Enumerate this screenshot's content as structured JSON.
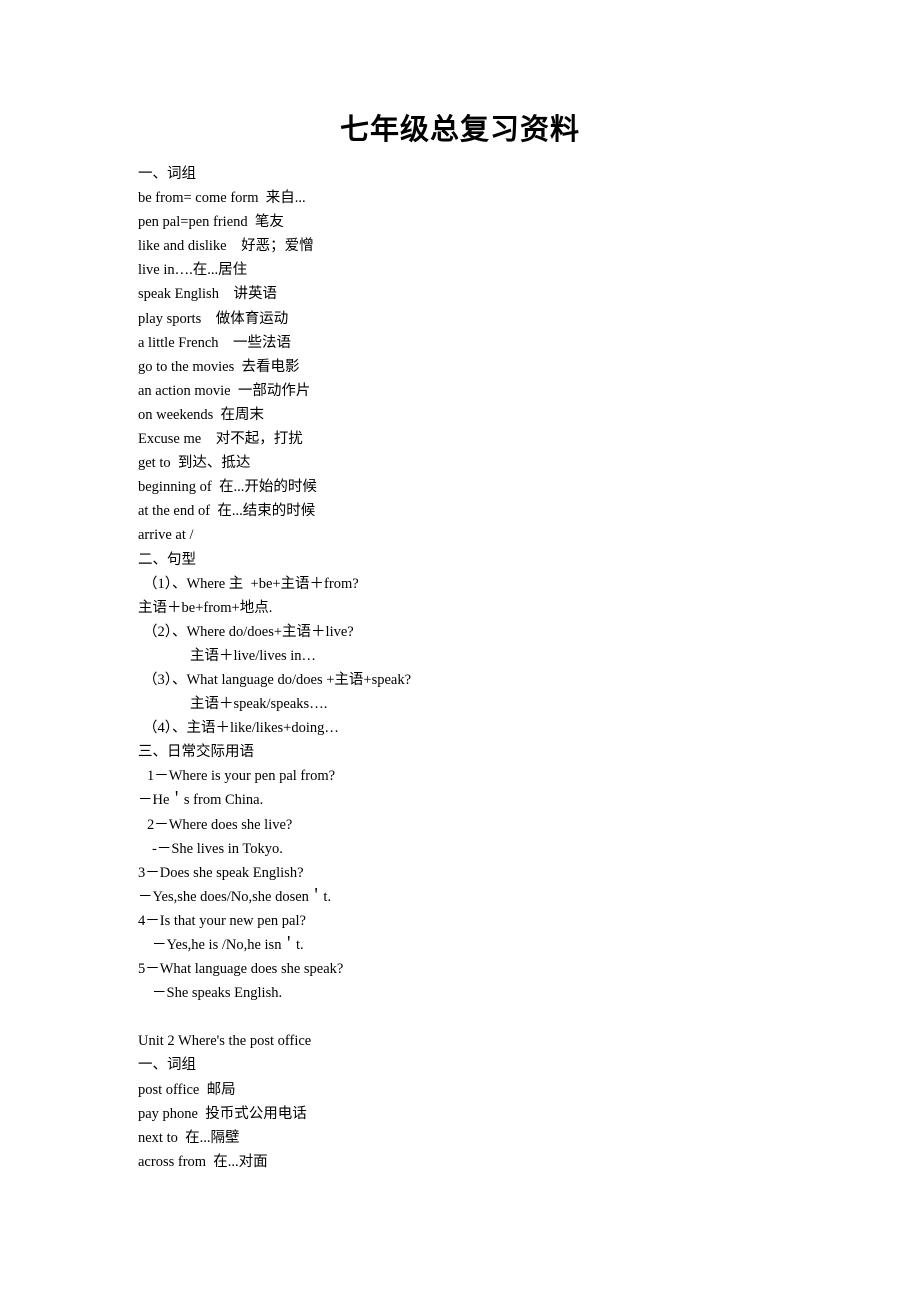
{
  "document": {
    "title": "七年级总复习资料",
    "lines": [
      {
        "text": "一、词组",
        "indent": "none"
      },
      {
        "text": "be from= come form  来自...",
        "indent": "none"
      },
      {
        "text": "pen pal=pen friend  笔友",
        "indent": "none"
      },
      {
        "text": "like and dislike    好恶；爱憎",
        "indent": "none"
      },
      {
        "text": "live in….在...居住",
        "indent": "none"
      },
      {
        "text": "speak English    讲英语",
        "indent": "none"
      },
      {
        "text": "play sports    做体育运动",
        "indent": "none"
      },
      {
        "text": "a little French    一些法语",
        "indent": "none"
      },
      {
        "text": "go to the movies  去看电影",
        "indent": "none"
      },
      {
        "text": "an action movie  一部动作片",
        "indent": "none"
      },
      {
        "text": "on weekends  在周末",
        "indent": "none"
      },
      {
        "text": "Excuse me    对不起，打扰",
        "indent": "none"
      },
      {
        "text": "get to  到达、抵达",
        "indent": "none"
      },
      {
        "text": "beginning of  在...开始的时候",
        "indent": "none"
      },
      {
        "text": "at the end of  在...结束的时候",
        "indent": "none"
      },
      {
        "text": "arrive at /",
        "indent": "none"
      },
      {
        "text": "二、句型",
        "indent": "none"
      },
      {
        "text": "（1）、Where 主  +be+主语＋from?",
        "indent": "indent-1"
      },
      {
        "text": "主语＋be+from+地点.",
        "indent": "none"
      },
      {
        "text": "（2）、Where do/does+主语＋live?",
        "indent": "indent-1"
      },
      {
        "text": "主语＋live/lives in…",
        "indent": "indent-3"
      },
      {
        "text": "（3）、What language do/does +主语+speak?",
        "indent": "indent-1"
      },
      {
        "text": "主语＋speak/speaks….",
        "indent": "indent-3"
      },
      {
        "text": "（4）、主语＋like/likes+doing…",
        "indent": "indent-1"
      },
      {
        "text": "三、日常交际用语",
        "indent": "none"
      },
      {
        "text": "1－Where is your pen pal from?",
        "indent": "indent-2"
      },
      {
        "text": "－He＇s from China.",
        "indent": "none"
      },
      {
        "text": "2－Where does she live?",
        "indent": "indent-2"
      },
      {
        "text": "-－She lives in Tokyo.",
        "indent": "indent-4"
      },
      {
        "text": "3－Does she speak English?",
        "indent": "none"
      },
      {
        "text": "－Yes,she does/No,she dosen＇t.",
        "indent": "none"
      },
      {
        "text": "4－Is that your new pen pal?",
        "indent": "none"
      },
      {
        "text": "－Yes,he is /No,he isn＇t.",
        "indent": "indent-4"
      },
      {
        "text": "5－What language does she speak?",
        "indent": "none"
      },
      {
        "text": "－She speaks English.",
        "indent": "indent-4"
      },
      {
        "text": "",
        "indent": "blank"
      },
      {
        "text": "Unit 2 Where's the post office",
        "indent": "none"
      },
      {
        "text": "一、词组",
        "indent": "none"
      },
      {
        "text": "post office  邮局",
        "indent": "none"
      },
      {
        "text": "pay phone  投币式公用电话",
        "indent": "none"
      },
      {
        "text": "next to  在...隔壁",
        "indent": "none"
      },
      {
        "text": "across from  在...对面",
        "indent": "none"
      }
    ]
  }
}
